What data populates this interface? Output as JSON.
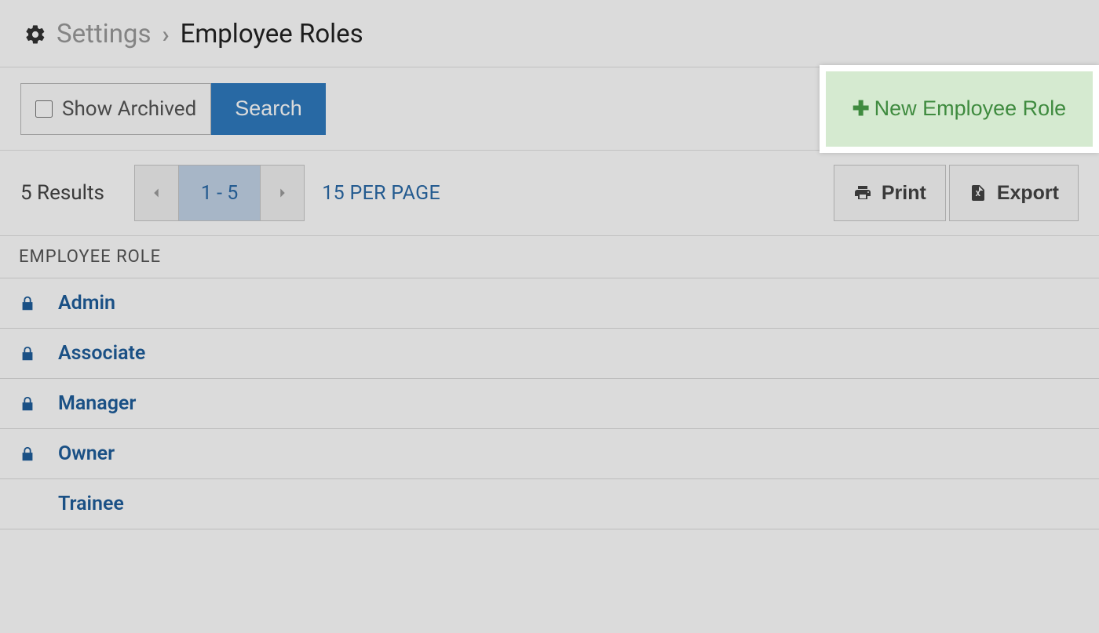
{
  "breadcrumb": {
    "parent": "Settings",
    "current": "Employee Roles"
  },
  "toolbar": {
    "show_archived_label": "Show Archived",
    "search_label": "Search",
    "new_role_label": "New Employee Role"
  },
  "results": {
    "count_text": "5 Results",
    "range": "1 - 5",
    "per_page": "15 PER PAGE",
    "print_label": "Print",
    "export_label": "Export"
  },
  "table": {
    "header": "EMPLOYEE ROLE",
    "rows": [
      {
        "name": "Admin",
        "locked": true
      },
      {
        "name": "Associate",
        "locked": true
      },
      {
        "name": "Manager",
        "locked": true
      },
      {
        "name": "Owner",
        "locked": true
      },
      {
        "name": "Trainee",
        "locked": false
      }
    ]
  }
}
